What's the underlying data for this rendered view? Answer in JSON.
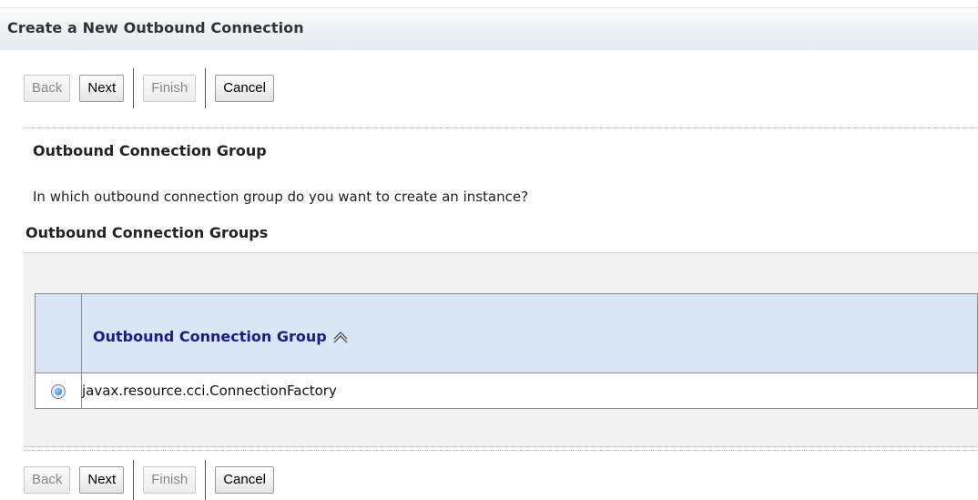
{
  "page": {
    "title": "Create a New Outbound Connection"
  },
  "buttons": {
    "back": "Back",
    "next": "Next",
    "finish": "Finish",
    "cancel": "Cancel"
  },
  "section": {
    "title": "Outbound Connection Group",
    "instruction": "In which outbound connection group do you want to create an instance?"
  },
  "table": {
    "title": "Outbound Connection Groups",
    "column_header": "Outbound Connection Group",
    "sort_icon": "sort-ascending-icon",
    "rows": [
      {
        "selected": true,
        "value": "javax.resource.cci.ConnectionFactory"
      }
    ]
  },
  "colors": {
    "header_bg": "#d8e6f6",
    "header_text": "#1a1a8c",
    "title_bar_bg": "#eef2f6"
  }
}
